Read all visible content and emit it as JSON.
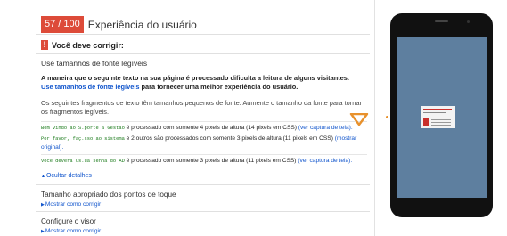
{
  "score": {
    "value": "57 / 100",
    "title": "Experiência do usuário"
  },
  "alert": {
    "icon": "exclamation-icon",
    "label": "Você deve corrigir:"
  },
  "rule": {
    "title": "Use tamanhos de fonte legíveis",
    "description_bold": "A maneira que o seguinte texto na sua página é processado dificulta a leitura de alguns visitantes.",
    "description_link": "Use tamanhos de fonte legíveis",
    "description_tail": "para fornecer uma melhor experiência do usuário.",
    "fragments_intro": "Os seguintes fragmentos de texto têm tamanhos pequenos de fonte. Aumente o tamanho da fonte para tornar os fragmentos legíveis."
  },
  "fragments": [
    {
      "code": "Bem vindo ao S.porte a Gestão",
      "text": "é processado com somente 4 pixels de altura (14 pixels em CSS)",
      "link": "(ver captura de tela)."
    },
    {
      "code": "Por favor, faç.sso ao sistema",
      "text": "e 2 outros são processados com somente 3 pixels de altura (11 pixels em CSS)",
      "link": "(mostrar original)."
    },
    {
      "code": "Você deverá us.ua senha do AD",
      "text": "é processado com somente 3 pixels de altura (11 pixels em CSS)",
      "link": "(ver captura de tela)."
    }
  ],
  "hide_details": "Ocultar detalhes",
  "sections": [
    {
      "title": "Tamanho apropriado dos pontos de toque",
      "link": "Mostrar como corrigir"
    },
    {
      "title": "Configure o visor",
      "link": "Mostrar como corrigir"
    }
  ],
  "colors": {
    "badge": "#dd4b39",
    "link": "#1155cc",
    "arrow": "#e8912c",
    "phone_screen": "#5e7f9f"
  }
}
